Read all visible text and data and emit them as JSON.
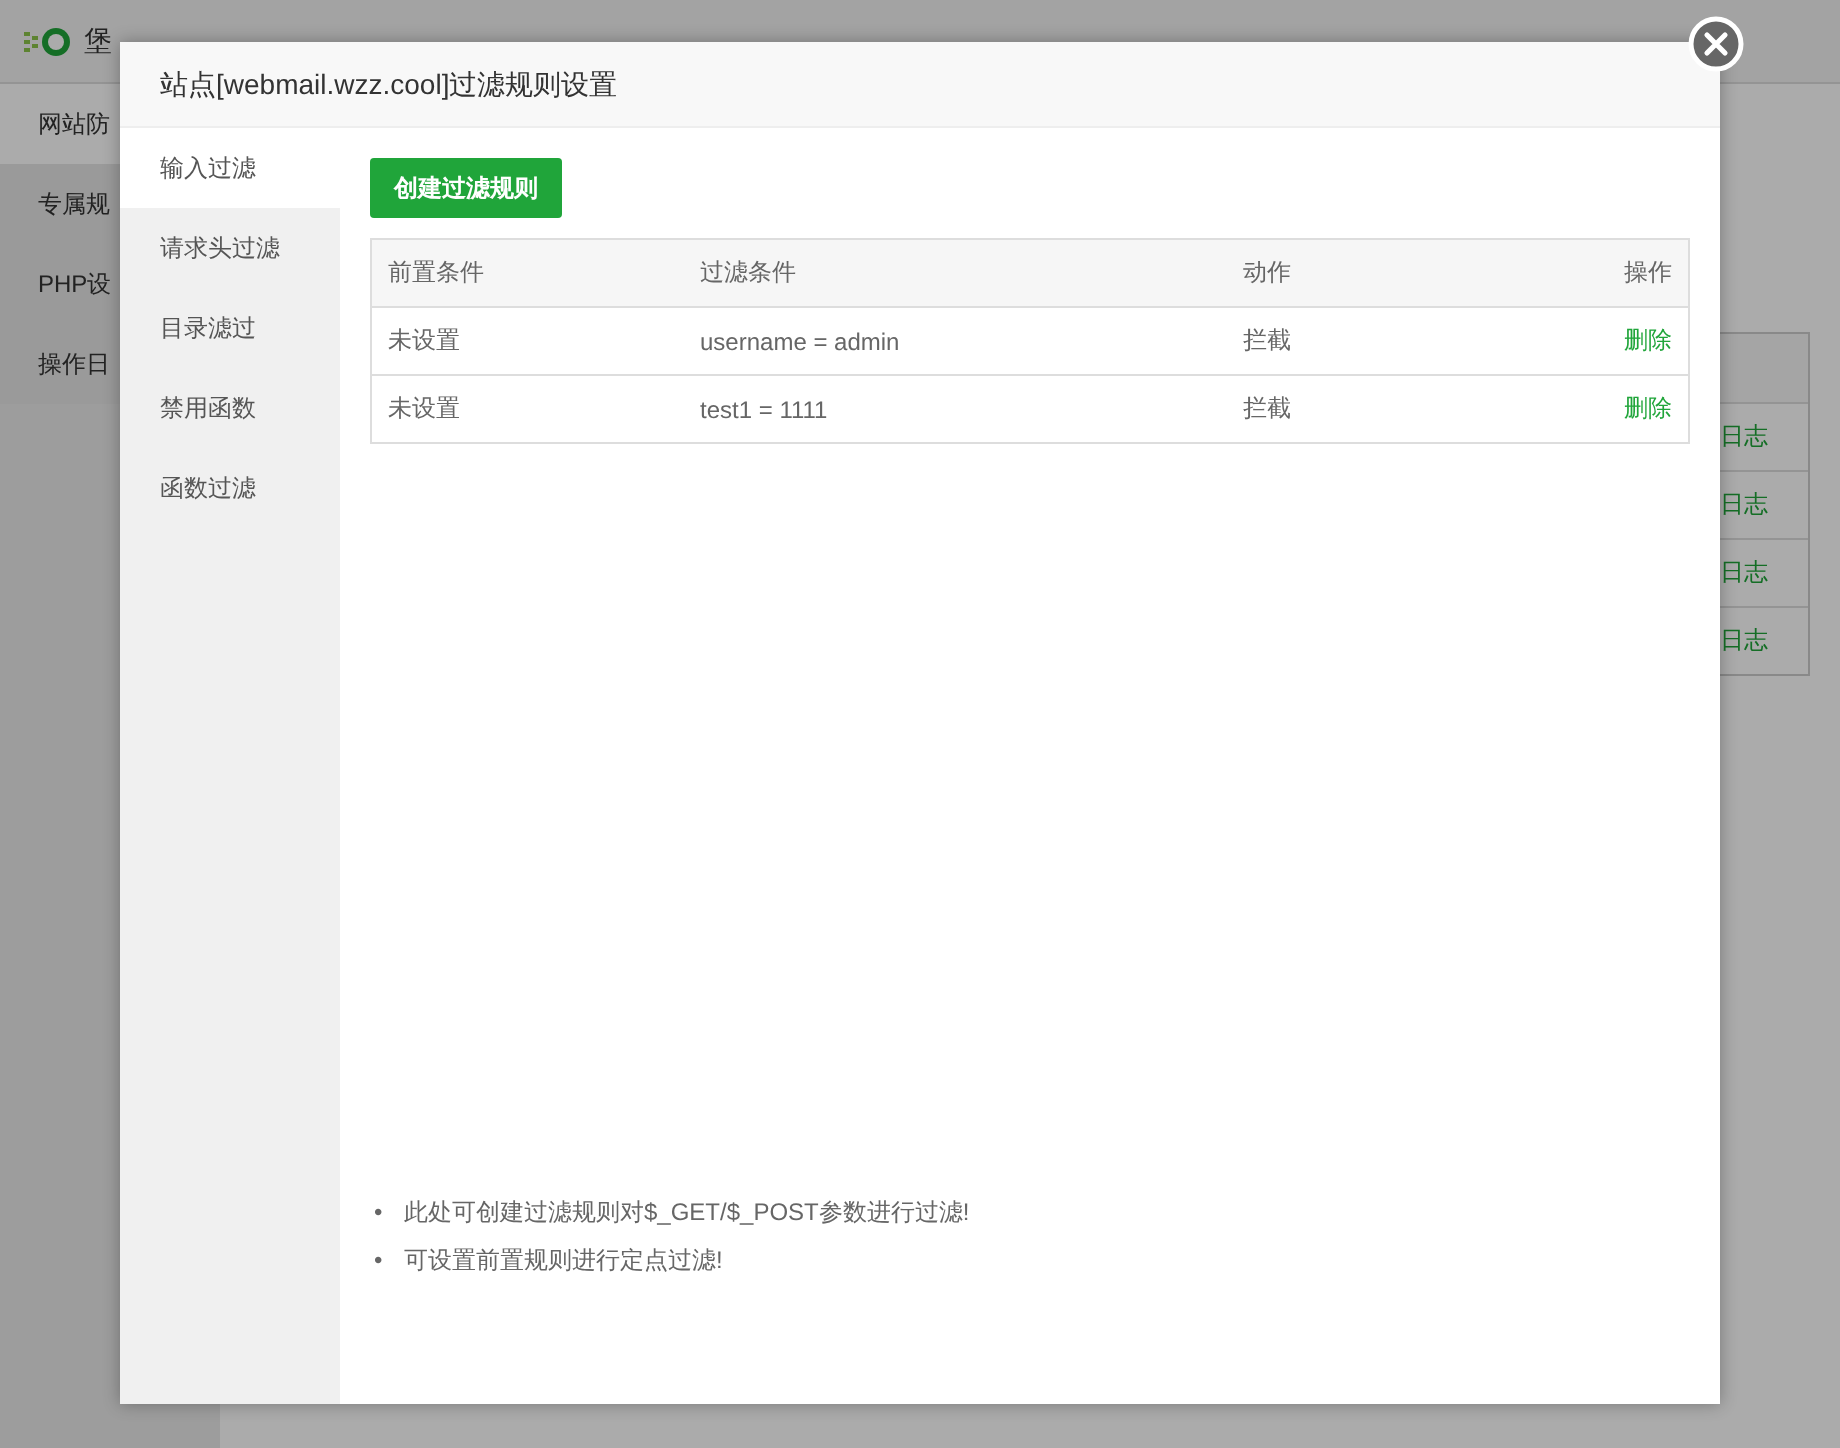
{
  "page": {
    "title": "堡",
    "sidebar": {
      "items": [
        {
          "label": "网站防",
          "selected": true
        },
        {
          "label": "专属规",
          "selected": false
        },
        {
          "label": "PHP设",
          "selected": false
        },
        {
          "label": "操作日",
          "selected": false
        }
      ]
    },
    "table": {
      "rows": [
        {
          "column_1": "日志"
        },
        {
          "column_1": "日志"
        },
        {
          "column_1": "日志"
        },
        {
          "column_1": "日志"
        }
      ]
    }
  },
  "dialog": {
    "title": "站点[webmail.wzz.cool]过滤规则设置",
    "tabs": [
      {
        "label": "输入过滤",
        "selected": true
      },
      {
        "label": "请求头过滤",
        "selected": false
      },
      {
        "label": "目录滤过",
        "selected": false
      },
      {
        "label": "禁用函数",
        "selected": false
      },
      {
        "label": "函数过滤",
        "selected": false
      }
    ],
    "create_button": "创建过滤规则",
    "table": {
      "columns": [
        "前置条件",
        "过滤条件",
        "动作",
        "操作"
      ],
      "rows": [
        {
          "precondition": "未设置",
          "condition": "username = admin",
          "action": "拦截",
          "operation": "删除"
        },
        {
          "precondition": "未设置",
          "condition": "test1 = 1111",
          "action": "拦截",
          "operation": "删除"
        }
      ]
    },
    "notes": [
      {
        "bullet": "•",
        "text": "此处可创建过滤规则对$_GET/$_POST参数进行过滤!"
      },
      {
        "bullet": "•",
        "text": "可设置前置规则进行定点过滤!"
      }
    ]
  }
}
